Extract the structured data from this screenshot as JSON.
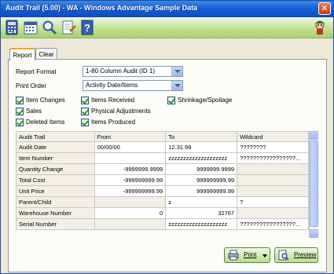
{
  "window": {
    "title": "Audit Trail (5.00) - WA - Windows Advantage Sample Data"
  },
  "toolbar": {
    "buttons": [
      "calculator-icon",
      "calendar-icon",
      "magnifier-icon",
      "notepad-icon",
      "help-icon"
    ],
    "mascot": "mascot-icon"
  },
  "tabs": [
    {
      "label": "Report",
      "active": true
    },
    {
      "label": "Clear",
      "active": false
    }
  ],
  "form": {
    "report_format_label": "Report Format",
    "report_format_value": "1-80 Column Audit (ID 1)",
    "print_order_label": "Print Order",
    "print_order_value": "Activity Date/Items"
  },
  "checkboxes": {
    "item_changes": "Item Changes",
    "sales": "Sales",
    "deleted_items": "Deleted Items",
    "items_received": "Items Received",
    "physical_adjustments": "Physical Adjustments",
    "items_produced": "Items Produced",
    "shrinkage_spoilage": "Shrinkage/Spoilage"
  },
  "grid": {
    "headers": [
      "Audit Trail",
      "From",
      "To",
      "Wildcard"
    ],
    "rows": [
      {
        "label": "Audit Date",
        "from": "00/00/00",
        "to": "12.31.99",
        "wildcard": "????????"
      },
      {
        "label": "Item Number",
        "from": "",
        "to": "zzzzzzzzzzzzzzzzzzzz",
        "wildcard": "?????????????????..."
      },
      {
        "label": "Quantity Change",
        "from": "-9999999.9999",
        "to": "9999999.9999",
        "wildcard": ""
      },
      {
        "label": "Total Cost",
        "from": "-999999999.99",
        "to": "999999999.99",
        "wildcard": ""
      },
      {
        "label": "Unit Price",
        "from": "-999999999.99",
        "to": "999999999.99",
        "wildcard": ""
      },
      {
        "label": "Parent/Child",
        "from": "",
        "to": "z",
        "wildcard": "?"
      },
      {
        "label": "Warehouse Number",
        "from": "0",
        "to": "32767",
        "wildcard": ""
      },
      {
        "label": "Serial Number",
        "from": "",
        "to": "zzzzzzzzzzzzzzzzzzzz",
        "wildcard": "?????????????????..."
      }
    ]
  },
  "buttons": {
    "print": "Print",
    "preview": "Preview"
  }
}
